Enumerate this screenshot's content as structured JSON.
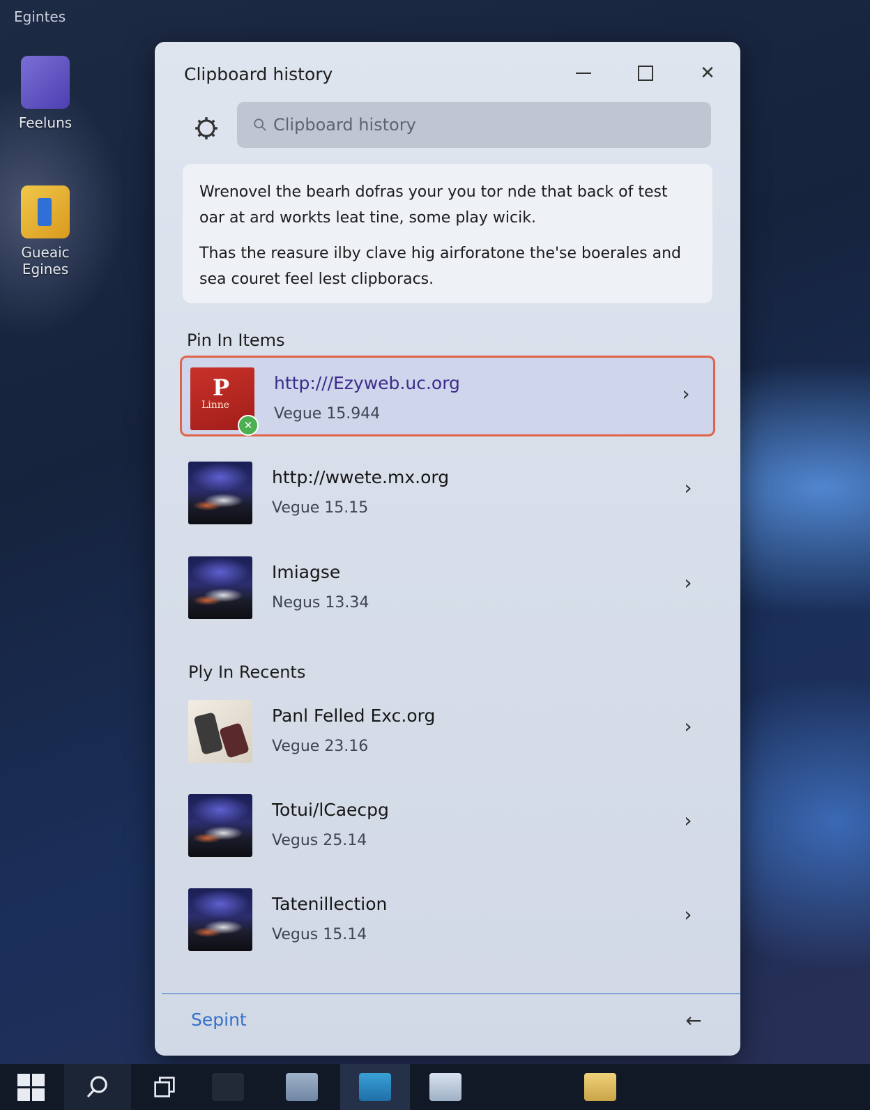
{
  "desktop": {
    "top_label": "Egintes",
    "icons": [
      {
        "label": "Feeluns"
      },
      {
        "label": "Gueaic Egines"
      }
    ]
  },
  "window": {
    "title": "Clipboard history",
    "controls": {
      "minimize": "—",
      "maximize": "□",
      "close": "✕"
    },
    "search": {
      "placeholder": "Clipboard history"
    },
    "info": {
      "paragraph1": "Wrenovel the bearh dofras your you tor nde that back of test oar at ard workts leat tine, some play wicik.",
      "paragraph2": "Thas the reasure ilby clave hig airforatone the'se boerales and sea couret feel lest clipboracs."
    },
    "pinned": {
      "heading": "Pin In Items",
      "items": [
        {
          "title": "http:///Ezyweb.uc.org",
          "subtitle": "Vegue 15.944",
          "thumb_text": "P",
          "thumb_small": "Linne"
        },
        {
          "title": "http://wwete.mx.org",
          "subtitle": "Vegue 15.15"
        },
        {
          "title": "Imiagse",
          "subtitle": "Negus 13.34"
        }
      ]
    },
    "recents": {
      "heading": "Ply In Recents",
      "items": [
        {
          "title": "Panl Felled Exc.org",
          "subtitle": "Vegue 23.16"
        },
        {
          "title": "Totui/lCaecpg",
          "subtitle": "Vegus 25.14"
        },
        {
          "title": "Tatenillection",
          "subtitle": "Vegus 15.14"
        }
      ]
    },
    "footer": {
      "link": "Sepint",
      "back_icon": "←"
    }
  },
  "colors": {
    "accent": "#3470c8",
    "selected_border": "#e06448"
  },
  "icons": [
    "gear-icon",
    "search-icon",
    "chevron-right-icon",
    "back-arrow-icon",
    "windows-logo-icon"
  ]
}
